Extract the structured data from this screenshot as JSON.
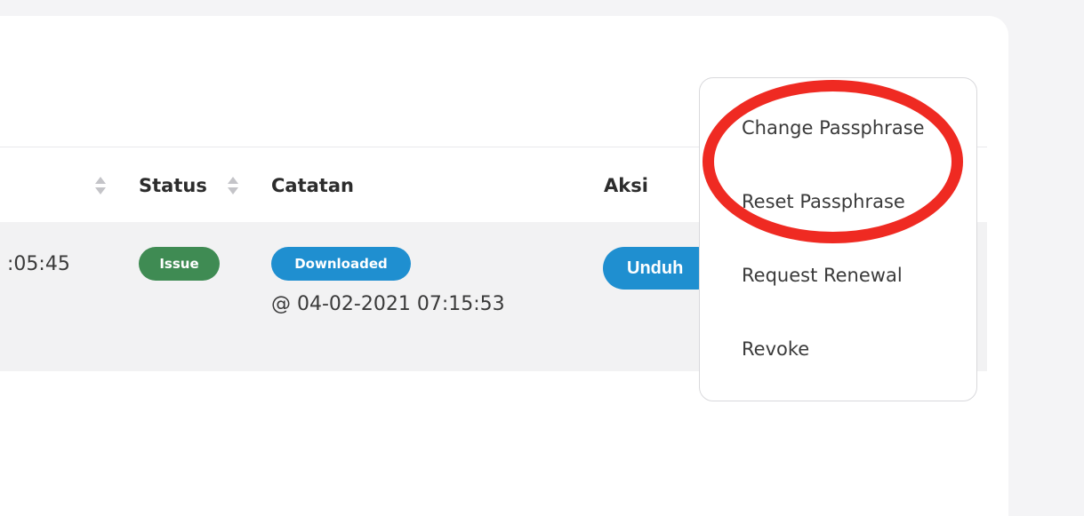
{
  "table": {
    "headers": {
      "status": "Status",
      "catatan": "Catatan",
      "aksi": "Aksi"
    },
    "row": {
      "time_fragment": ":05:45",
      "status_badge": "Issue",
      "catatan_badge": "Downloaded",
      "catatan_time": "@ 04-02-2021 07:15:53",
      "action_button": "Unduh"
    }
  },
  "dropdown_menu": {
    "items": [
      "Change Passphrase",
      "Reset Passphrase",
      "Request Renewal",
      "Revoke"
    ]
  },
  "colors": {
    "issue_badge": "#3f8b53",
    "primary_blue": "#1f8fd0",
    "highlight_circle": "#ef2a22"
  }
}
